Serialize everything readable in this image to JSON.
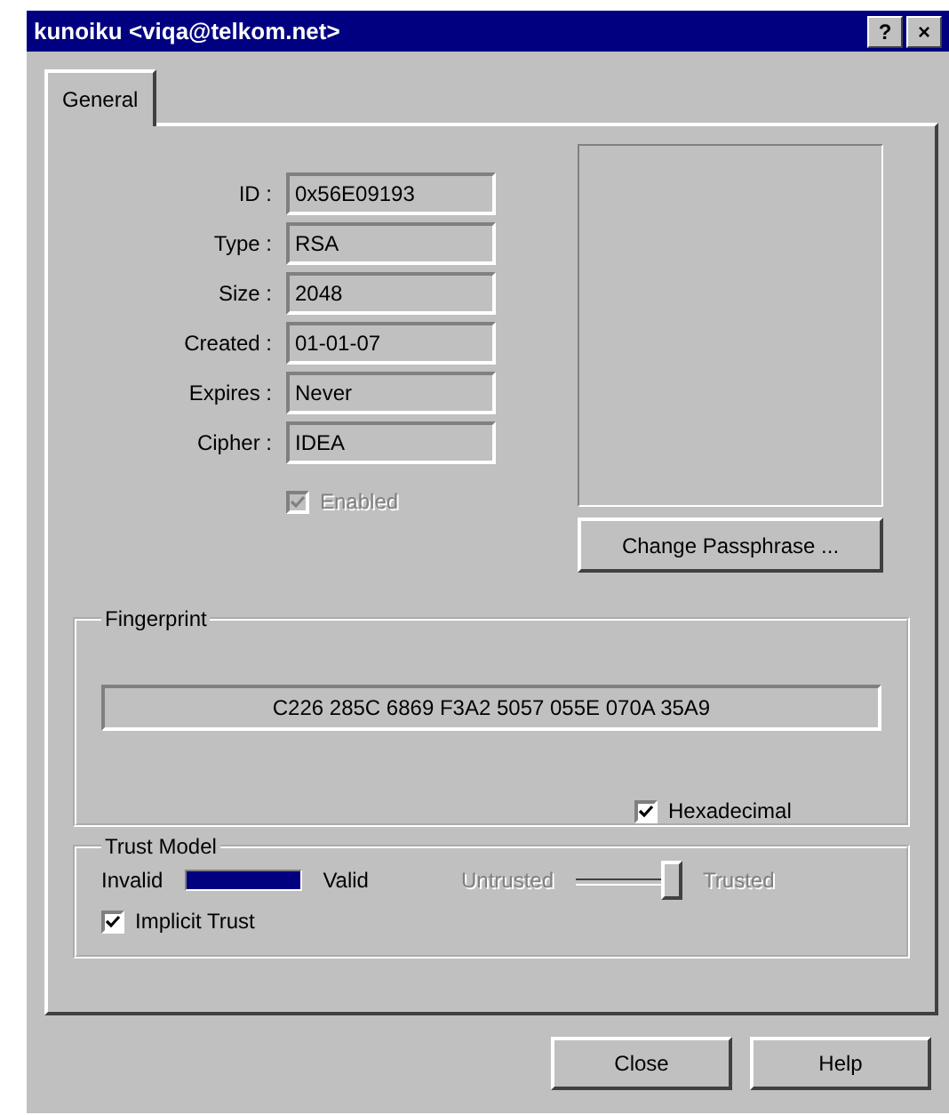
{
  "window": {
    "title": "kunoiku <viqa@telkom.net>"
  },
  "title_buttons": [
    "?",
    "×"
  ],
  "tabs": [
    {
      "label": "General",
      "selected": true
    }
  ],
  "fields": [
    {
      "label": "ID :",
      "value": "0x56E09193"
    },
    {
      "label": "Type :",
      "value": "RSA"
    },
    {
      "label": "Size :",
      "value": "2048"
    },
    {
      "label": "Created :",
      "value": "01-01-07"
    },
    {
      "label": "Expires :",
      "value": "Never"
    },
    {
      "label": "Cipher :",
      "value": "IDEA"
    }
  ],
  "enabled": {
    "label": "Enabled",
    "checked": true,
    "disabled": true
  },
  "change_passphrase": "Change Passphrase ...",
  "fingerprint": {
    "title": "Fingerprint",
    "value": "C226 285C 6869 F3A2  5057 055E 070A 35A9",
    "hexadecimal": {
      "label": "Hexadecimal",
      "checked": true,
      "disabled": false
    }
  },
  "trust_model": {
    "title": "Trust Model",
    "invalid": "Invalid",
    "valid": "Valid",
    "validity": {
      "level": 1
    },
    "untrusted": "Untrusted",
    "trusted": "Trusted",
    "trust": {
      "level": 1,
      "disabled": true
    },
    "implicit_trust": {
      "label": "Implicit Trust",
      "checked": true,
      "disabled": false
    }
  },
  "buttons": [
    "Close",
    "Help"
  ]
}
